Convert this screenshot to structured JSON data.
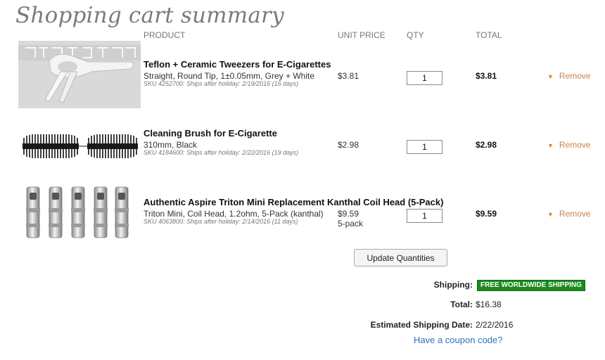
{
  "page": {
    "title": "Shopping cart summary"
  },
  "columns": {
    "product": "PRODUCT",
    "unit_price": "UNIT PRICE",
    "qty": "QTY",
    "total": "TOTAL"
  },
  "items": [
    {
      "name": "Teflon + Ceramic Tweezers for E-Cigarettes",
      "desc": "Straight, Round Tip, 1±0.05mm, Grey + White",
      "sku": "SKU 4252700: Ships after holiday: 2/19/2016 (16 days)",
      "unit_price": "$3.81",
      "unit_note": "",
      "qty": "1",
      "total": "$3.81",
      "remove": "Remove",
      "thumb_icon": "tweezers-image"
    },
    {
      "name": "Cleaning Brush for E-Cigarette",
      "desc": "310mm, Black",
      "sku": "SKU 4184600: Ships after holiday: 2/22/2016 (19 days)",
      "unit_price": "$2.98",
      "unit_note": "",
      "qty": "1",
      "total": "$2.98",
      "remove": "Remove",
      "thumb_icon": "cleaning-brush-image"
    },
    {
      "name": "Authentic Aspire Triton Mini Replacement Kanthal Coil Head (5-Pack)",
      "desc": "Triton Mini, Coil Head, 1.2ohm, 5-Pack (kanthal)",
      "sku": "SKU 4063800: Ships after holiday: 2/14/2016 (11 days)",
      "unit_price": "$9.59",
      "unit_note": "5-pack",
      "qty": "1",
      "total": "$9.59",
      "remove": "Remove",
      "thumb_icon": "coil-heads-image"
    }
  ],
  "update_button": "Update Quantities",
  "summary": {
    "shipping_label": "Shipping:",
    "shipping_value": "FREE WORLDWIDE SHIPPING",
    "total_label": "Total:",
    "total_value": "$16.38",
    "est_label": "Estimated Shipping Date:",
    "est_value": "2/22/2016",
    "coupon_link": "Have a coupon code?"
  },
  "colors": {
    "remove_link": "#c8844a",
    "remove_arrow": "#e0802a",
    "free_badge": "#1b8a1b",
    "coupon_link": "#2f73b7",
    "title": "#7b7b7b"
  }
}
